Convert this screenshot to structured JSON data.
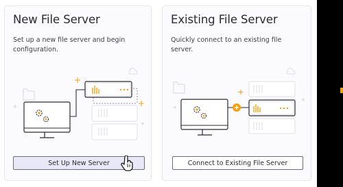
{
  "cards": {
    "new": {
      "title": "New File Server",
      "description": "Set up a new file server and begin configuration.",
      "button_label": "Set Up New Server"
    },
    "existing": {
      "title": "Existing File Server",
      "description": "Quickly connect to an existing file server.",
      "button_label": "Connect to Existing File Server"
    }
  },
  "colors": {
    "accent": "#f2a30f",
    "card_bg": "#fbfafd",
    "primary_button_bg": "#e9e8f6",
    "outline": "#2b2b33"
  },
  "icons": [
    "computer-icon",
    "gear-icon",
    "server-icon",
    "folder-icon",
    "cloud-icon",
    "plus-sparkle-icon",
    "hand-cursor-icon"
  ]
}
